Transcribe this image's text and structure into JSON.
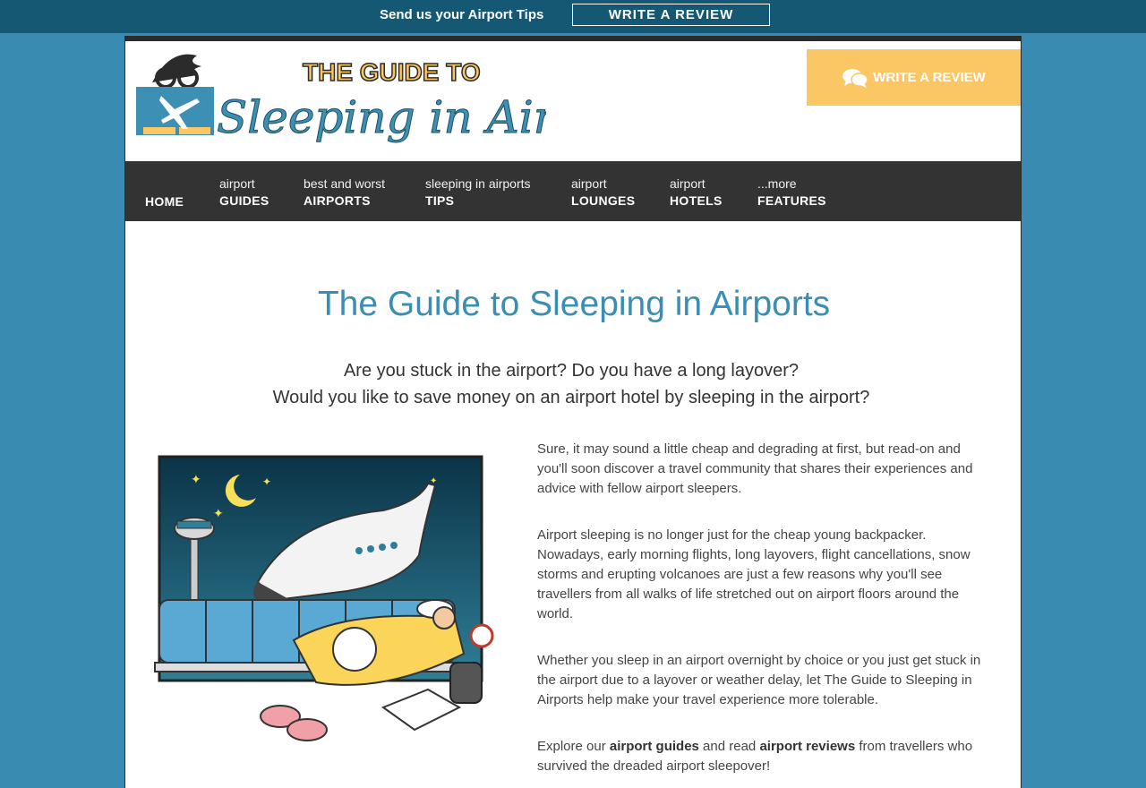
{
  "topbar": {
    "text": "Send us your Airport Tips",
    "button": "WRITE A REVIEW"
  },
  "header": {
    "cta": "WRITE A REVIEW",
    "logo_alt": "THE GUIDE TO Sleeping in Airports"
  },
  "nav": [
    {
      "top": "",
      "bottom": "HOME"
    },
    {
      "top": "airport",
      "bottom": "GUIDES"
    },
    {
      "top": "best and worst",
      "bottom": "AIRPORTS"
    },
    {
      "top": "sleeping in airports",
      "bottom": "TIPS"
    },
    {
      "top": "airport",
      "bottom": "LOUNGES"
    },
    {
      "top": "airport",
      "bottom": "HOTELS"
    },
    {
      "top": "...more",
      "bottom": "FEATURES"
    }
  ],
  "main": {
    "title": "The Guide to Sleeping in Airports",
    "intro1": "Are you stuck in the airport? Do you have a long layover?",
    "intro2": "Would you like to save money on an airport hotel by sleeping in the airport?",
    "p1": "Sure, it may sound a little cheap and degrading at first, but read-on and you'll soon discover a travel community that shares their experiences and advice with fellow airport sleepers.",
    "p2": "Airport sleeping is no longer just for the cheap young backpacker. Nowadays, early morning flights, long layovers, flight cancellations, snow storms and erupting volcanoes are just a few reasons why you'll see travellers from all walks of life stretched out on airport floors around the world.",
    "p3": "Whether you sleep in an airport overnight by choice or you just get stuck in the airport due to a layover or weather delay, let The Guide to Sleeping in Airports help make your travel experience more tolerable.",
    "p4_pre": "Explore our ",
    "p4_link1": "airport guides",
    "p4_mid": " and read ",
    "p4_link2": "airport reviews",
    "p4_post": " from travellers who survived the dreaded airport sleepover!"
  },
  "colors": {
    "background": "#3a8bb2",
    "topbar": "#155873",
    "nav": "#333333",
    "cta": "#fbc664",
    "title": "#3a8eb3"
  },
  "icons": [
    "chat-bubbles-icon"
  ]
}
